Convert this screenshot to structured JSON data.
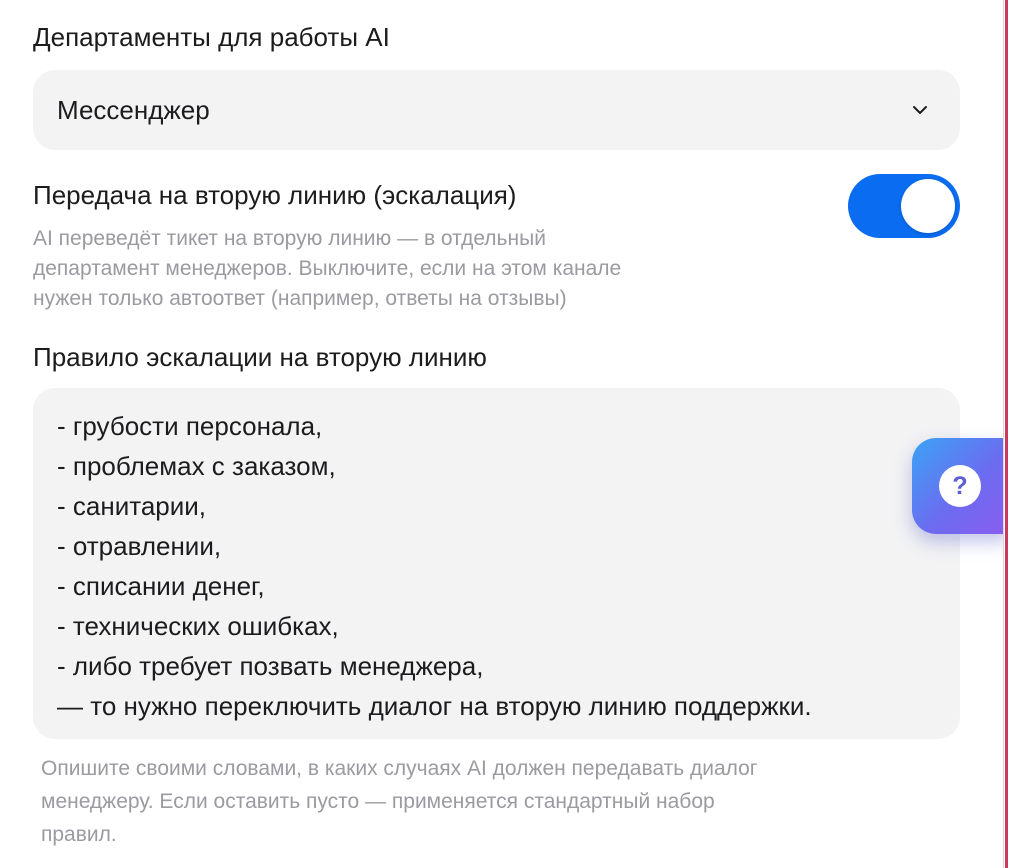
{
  "departments": {
    "label": "Департаменты для работы AI",
    "selected": "Мессенджер",
    "chevron_icon": "chevron-down-icon"
  },
  "escalation_toggle": {
    "label": "Передача на вторую линию (эскалация)",
    "enabled": true,
    "accent_color": "#0a6cf0",
    "hint_lines": [
      "AI переведёт тикет на вторую линию — в отдельный",
      "департамент менеджеров. Выключите, если на этом канале",
      "нужен только автоответ (например, ответы на отзывы)"
    ]
  },
  "escalation_rule": {
    "label": "Правило эскалации на вторую линию",
    "lines": [
      "- грубости персонала,",
      "- проблемах с заказом,",
      "- санитарии,",
      "- отравлении,",
      "- списании денег,",
      "- технических ошибках,",
      "- либо требует позвать менеджера,",
      "— то нужно переключить диалог на вторую линию поддержки."
    ],
    "hint_lines": [
      "Опишите своими словами, в каких случаях AI должен передавать диалог",
      "менеджеру. Если оставить пусто — применяется стандартный набор",
      "правил."
    ]
  },
  "help_button": {
    "symbol": "?",
    "icon": "help-icon"
  }
}
